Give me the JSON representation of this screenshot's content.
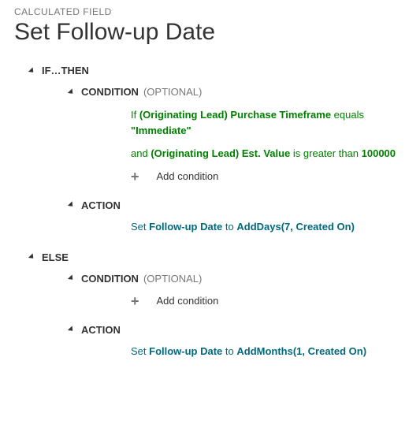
{
  "header": {
    "label": "CALCULATED FIELD",
    "title": "Set Follow-up Date"
  },
  "ifthen": {
    "title": "IF…THEN",
    "condition": {
      "title": "CONDITION",
      "optional": "(OPTIONAL)",
      "line1": {
        "prefix": "If ",
        "field": "(Originating Lead) Purchase Timeframe",
        "op": " equals ",
        "value": "\"Immediate\""
      },
      "line2": {
        "prefix": "and ",
        "field": "(Originating Lead) Est. Value",
        "op": " is greater than ",
        "value": "100000"
      },
      "add": "Add condition"
    },
    "action": {
      "title": "ACTION",
      "line": {
        "prefix": "Set ",
        "field": "Follow-up Date",
        "mid": " to ",
        "expr": "AddDays(7, Created On)"
      }
    }
  },
  "else": {
    "title": "ELSE",
    "condition": {
      "title": "CONDITION",
      "optional": "(OPTIONAL)",
      "add": "Add condition"
    },
    "action": {
      "title": "ACTION",
      "line": {
        "prefix": "Set ",
        "field": "Follow-up Date",
        "mid": " to ",
        "expr": "AddMonths(1, Created On)"
      }
    }
  }
}
